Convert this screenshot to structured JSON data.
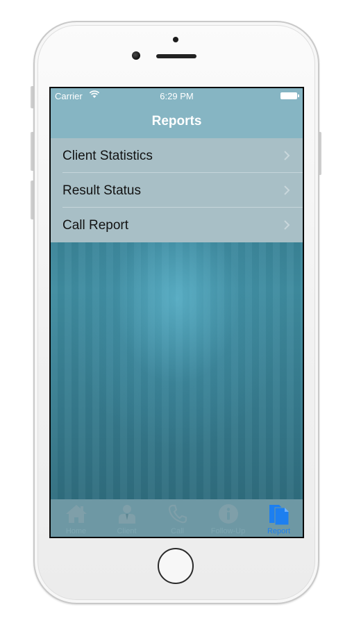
{
  "status_bar": {
    "carrier": "Carrier",
    "time": "6:29 PM"
  },
  "nav": {
    "title": "Reports"
  },
  "menu": {
    "items": [
      {
        "label": "Client Statistics"
      },
      {
        "label": "Result Status"
      },
      {
        "label": "Call Report"
      }
    ]
  },
  "tabbar": {
    "tabs": [
      {
        "label": "Home",
        "icon": "home-icon"
      },
      {
        "label": "Client",
        "icon": "client-icon"
      },
      {
        "label": "Call",
        "icon": "phone-icon"
      },
      {
        "label": "Follow-Up",
        "icon": "info-icon"
      },
      {
        "label": "Report",
        "icon": "report-icon",
        "active": true
      }
    ]
  },
  "colors": {
    "accent": "#1d7ff0",
    "nav_bar": "#86b5c3",
    "list_bg": "#a8bfc6",
    "background": "#3f8ca0"
  }
}
